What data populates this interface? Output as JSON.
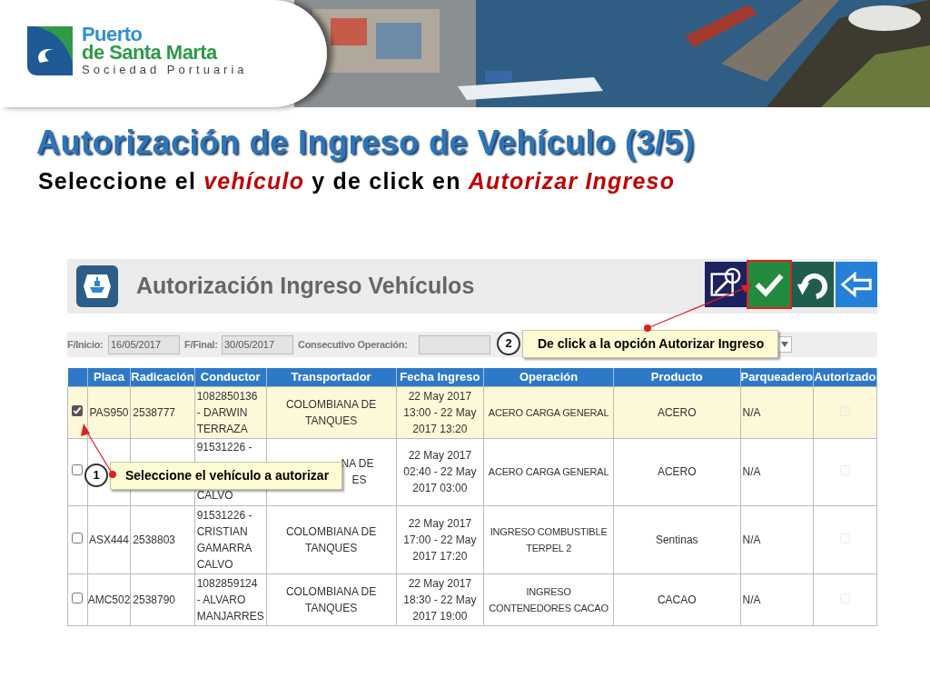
{
  "header": {
    "logo": {
      "line1": "Puerto",
      "line2": "de Santa Marta",
      "line3": "Sociedad Portuaria"
    }
  },
  "title": "Autorización de Ingreso de Vehículo (3/5)",
  "subtitle": "Seleccione el *vehículo* y de click en *Autorizar Ingreso*",
  "app": {
    "title": "Autorización Ingreso Vehículos",
    "toolbar": [
      {
        "kind": "search-edit",
        "highlighted": false
      },
      {
        "kind": "check",
        "highlighted": true
      },
      {
        "kind": "undo",
        "highlighted": false
      },
      {
        "kind": "back",
        "highlighted": false
      }
    ],
    "filters": [
      {
        "label": "F/Inicio:",
        "value": "16/05/2017"
      },
      {
        "label": "F/Final:",
        "value": "30/05/2017"
      },
      {
        "label": "Consecutivo Operación:"
      }
    ],
    "table": {
      "columns": [
        "Placa",
        "Radicación",
        "Conductor",
        "Transportador",
        "Fecha Ingreso",
        "Operación",
        "Producto",
        "Parqueadero",
        "Autorizado"
      ],
      "rows": [
        {
          "selected": true,
          "checked": true,
          "placa": "PAS950",
          "radicacion": "2538777",
          "conductor": [
            "1082850136 - DARWIN TERRAZA"
          ],
          "transportador": [
            "COLOMBIANA DE TANQUES"
          ],
          "fecha": "22 May 2017 13:00 - 22 May 2017 13:20",
          "operacion": "ACERO CARGA GENERAL",
          "producto": "ACERO",
          "parqueadero": "N/A",
          "autorizado": false
        },
        {
          "selected": false,
          "checked": false,
          "conductor": [
            "91531226 -",
            "CALVO"
          ],
          "transportador": [
            "NA DE",
            "ES"
          ],
          "fecha": "22 May 2017 02:40 - 22 May 2017 03:00",
          "operacion": "ACERO CARGA GENERAL",
          "producto": "ACERO",
          "parqueadero": "N/A",
          "autorizado": false
        },
        {
          "selected": false,
          "checked": false,
          "placa": "ASX444",
          "radicacion": "2538803",
          "conductor": [
            "91531226 - CRISTIAN GAMARRA CALVO"
          ],
          "transportador": [
            "COLOMBIANA DE TANQUES"
          ],
          "fecha": "22 May 2017 17:00 - 22 May 2017 17:20",
          "operacion": "INGRESO COMBUSTIBLE TERPEL 2",
          "producto": "Sentinas",
          "parqueadero": "N/A",
          "autorizado": false
        },
        {
          "selected": false,
          "checked": false,
          "placa": "AMC502",
          "radicacion": "2538790",
          "conductor": [
            "1082859124 - ALVARO MANJARRES"
          ],
          "transportador": [
            "COLOMBIANA DE TANQUES"
          ],
          "fecha": "22 May 2017 18:30 - 22 May 2017 19:00",
          "operacion": "INGRESO CONTENEDORES CACAO",
          "producto": "CACAO",
          "parqueadero": "N/A",
          "autorizado": false
        }
      ]
    }
  },
  "callouts": [
    {
      "number": "2",
      "text": "De click a la opción Autorizar Ingreso"
    },
    {
      "number": "1",
      "text": "Seleccione el vehículo a autorizar"
    }
  ]
}
